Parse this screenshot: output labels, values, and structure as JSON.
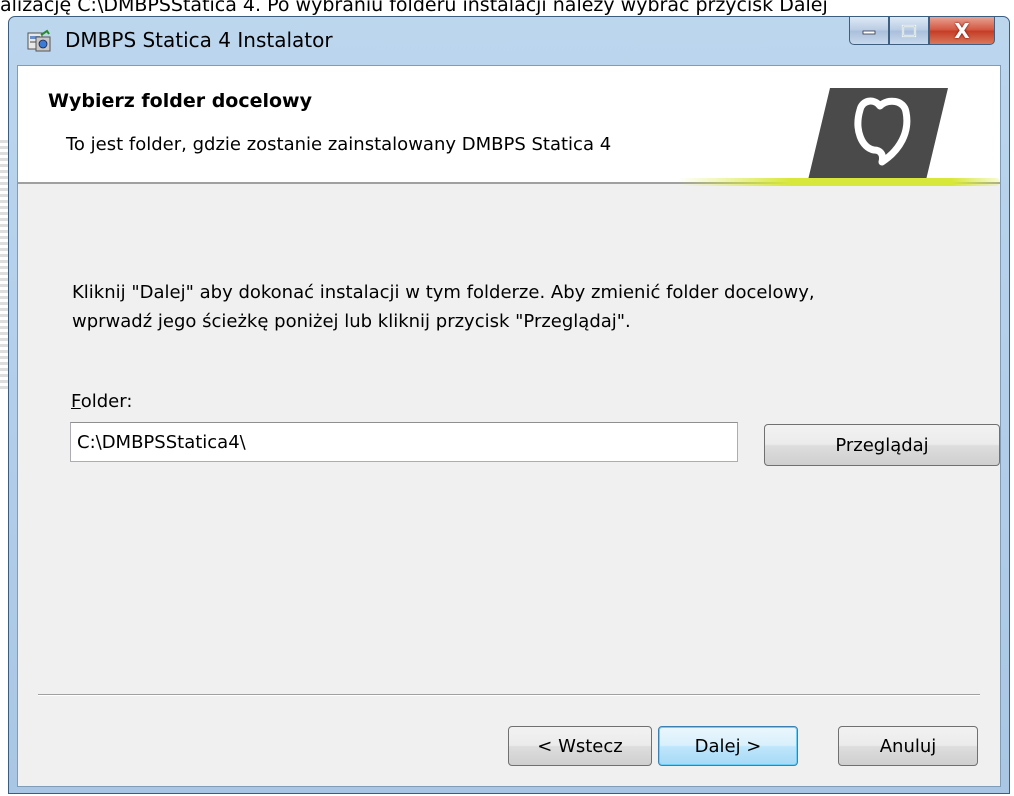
{
  "page_caption": "alizację C:\\DMBPSStatica 4. Po wybraniu folderu instalacji należy wybrać przycisk Dalej",
  "window": {
    "title": "DMBPS Statica 4 Instalator",
    "controls": {
      "minimize_icon": "minimize-icon",
      "maximize_icon": "maximize-icon",
      "close_label": "X"
    }
  },
  "banner": {
    "title": "Wybierz folder docelowy",
    "subtitle": "To jest folder, gdzie zostanie zainstalowany DMBPS Statica 4",
    "logo_icon": "shield-logo-icon"
  },
  "instructions": {
    "line1": "Kliknij \"Dalej\" aby dokonać instalacji w tym folderze. Aby zmienić folder docelowy,",
    "line2": "wprwadź jego ścieżkę poniżej lub kliknij przycisk \"Przeglądaj\"."
  },
  "folder": {
    "label_accel": "F",
    "label_rest": "older:",
    "value": "C:\\DMBPSStatica4\\"
  },
  "buttons": {
    "browse": "Przeglądaj",
    "back": "< Wstecz",
    "next": "Dalej >",
    "cancel": "Anuluj"
  },
  "colors": {
    "accent_glow": "#d8e83a",
    "logo_dark": "#4a4a4a",
    "titlebar": "#bcd6ee"
  }
}
